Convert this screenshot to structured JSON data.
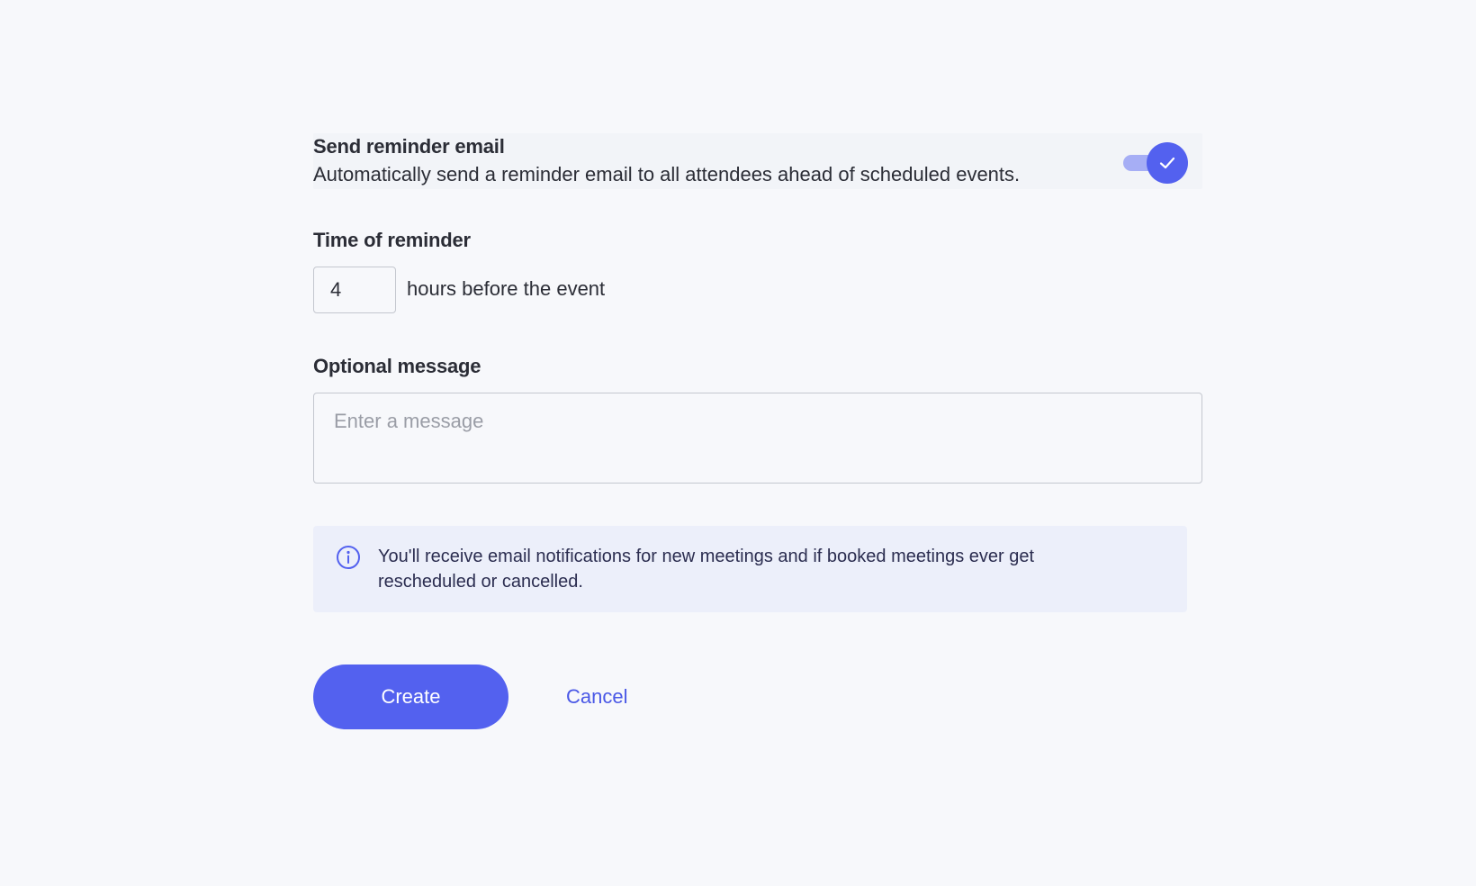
{
  "reminder": {
    "title": "Send reminder email",
    "description": "Automatically send a reminder email to all attendees ahead of scheduled events.",
    "enabled": true
  },
  "time_of_reminder": {
    "label": "Time of reminder",
    "value": "4",
    "suffix": "hours before the event"
  },
  "optional_message": {
    "label": "Optional message",
    "placeholder": "Enter a message",
    "value": ""
  },
  "info": {
    "icon": "info-icon",
    "text": "You'll receive email notifications for new meetings and if booked meetings ever get rescheduled or cancelled."
  },
  "actions": {
    "create_label": "Create",
    "cancel_label": "Cancel"
  },
  "colors": {
    "accent": "#5361ef",
    "accent_light": "#a6aef5",
    "banner_bg": "#eceffa",
    "page_bg": "#f7f8fb"
  }
}
